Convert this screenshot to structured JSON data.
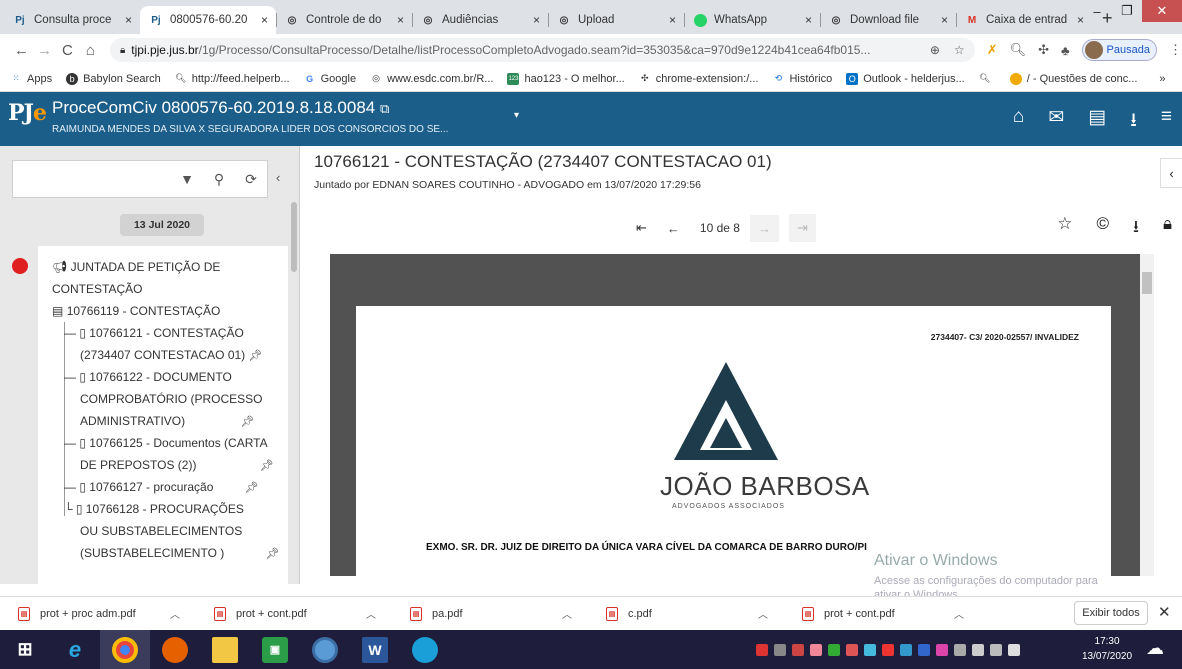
{
  "browser": {
    "tabs": [
      {
        "icon": "Pj",
        "title": "Consulta proce",
        "close": "×"
      },
      {
        "icon": "Pj",
        "title": "0800576-60.20",
        "close": "×",
        "active": true
      },
      {
        "icon": "globe",
        "title": "Controle de do",
        "close": "×"
      },
      {
        "icon": "globe",
        "title": "Audiências",
        "close": "×"
      },
      {
        "icon": "globe",
        "title": "Upload",
        "close": "×"
      },
      {
        "icon": "whatsapp",
        "title": "WhatsApp",
        "close": "×"
      },
      {
        "icon": "globe",
        "title": "Download file",
        "close": "×"
      },
      {
        "icon": "gmail",
        "title": "Caixa de entrad",
        "close": "×"
      }
    ],
    "new_tab": "+",
    "url_domain": "tjpi.pje.jus.br",
    "url_path": "/1g/Processo/ConsultaProcesso/Detalhe/listProcessoCompletoAdvogado.seam?id=353035&ca=970d9e1224b41cea64fb015...",
    "profile_status": "Pausada",
    "bookmarks": [
      {
        "icon": "apps-icon",
        "label": "Apps"
      },
      {
        "icon": "babylon-icon",
        "label": "Babylon Search"
      },
      {
        "icon": "search-icon",
        "label": "http://feed.helperb..."
      },
      {
        "icon": "google-icon",
        "label": "Google"
      },
      {
        "icon": "globe-icon",
        "label": "www.esdc.com.br/R..."
      },
      {
        "icon": "hao123-icon",
        "label": "hao123 - O melhor..."
      },
      {
        "icon": "extension-icon",
        "label": "chrome-extension:/..."
      },
      {
        "icon": "history-icon",
        "label": "Histórico"
      },
      {
        "icon": "outlook-icon",
        "label": "Outlook - helderjus..."
      },
      {
        "icon": "search-icon",
        "label": ""
      },
      {
        "icon": "questions-icon",
        "label": "/ - Questões de conc..."
      }
    ],
    "bookmarks_more": "»"
  },
  "pje": {
    "logo": "PJe",
    "process_title": "ProceComCiv 0800576-60.2019.8.18.0084",
    "parties": "RAIMUNDA MENDES DA SILVA X SEGURADORA LIDER DOS CONSORCIOS DO SE..."
  },
  "sidebar": {
    "date_label": "13 Jul 2020",
    "tree": {
      "event_line1": "JUNTADA DE PETIÇÃO DE",
      "event_line2": "CONTESTAÇÃO",
      "folder": "10766119 - CONTESTAÇÃO",
      "doc1_l1": "10766121 - CONTESTAÇÃO",
      "doc1_l2": "(2734407 CONTESTACAO 01)",
      "doc2_l1": "10766122 - DOCUMENTO",
      "doc2_l2": "COMPROBATÓRIO (PROCESSO",
      "doc2_l3": "ADMINISTRATIVO)",
      "doc3_l1": "10766125 - Documentos (CARTA",
      "doc3_l2": "DE PREPOSTOS (2))",
      "doc4_l1": "10766127 - procuração",
      "doc5_l1": "10766128 - PROCURAÇÕES",
      "doc5_l2": "OU SUBSTABELECIMENTOS",
      "doc5_l3": "(SUBSTABELECIMENTO )"
    }
  },
  "document": {
    "title": "10766121 - CONTESTAÇÃO (2734407 CONTESTACAO 01)",
    "attached_by": "Juntado por EDNAN SOARES COUTINHO - ADVOGADO em 13/07/2020 17:29:56",
    "page_indicator": "10 de 8",
    "page_ref": "2734407- C3/ 2020-02557/ INVALIDEZ",
    "firm_name": "JOÃO BARBOSA",
    "firm_sub": "ADVOGADOS ASSOCIADOS",
    "salutation": "EXMO. SR. DR. JUIZ DE DIREITO DA ÚNICA VARA CÍVEL DA COMARCA DE BARRO DURO/PI"
  },
  "watermark": {
    "line1": "Ativar o Windows",
    "line2": "Acesse as configurações do computador para",
    "line3": "ativar o Windows."
  },
  "downloads": {
    "items": [
      {
        "name": "prot + proc adm.pdf"
      },
      {
        "name": "prot + cont.pdf"
      },
      {
        "name": "pa.pdf"
      },
      {
        "name": "c.pdf"
      },
      {
        "name": "prot + cont.pdf"
      }
    ],
    "show_all": "Exibir todos"
  },
  "taskbar": {
    "time": "17:30",
    "date": "13/07/2020"
  },
  "colors": {
    "pje_header": "#1c5e8a",
    "status_dot": "#e02020",
    "taskbar": "#1e1e3c"
  }
}
